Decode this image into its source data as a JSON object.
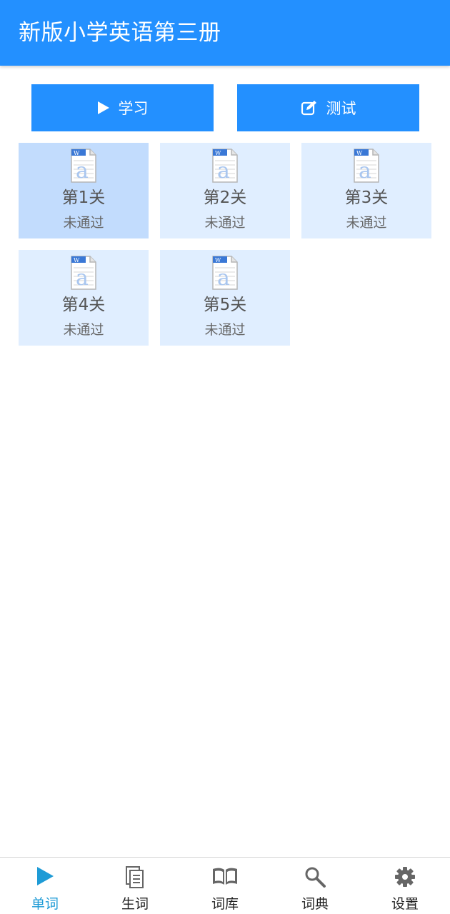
{
  "header": {
    "title": "新版小学英语第三册"
  },
  "actions": {
    "study_label": "学习",
    "test_label": "测试"
  },
  "levels": [
    {
      "name": "第1关",
      "status": "未通过",
      "selected": true
    },
    {
      "name": "第2关",
      "status": "未通过"
    },
    {
      "name": "第3关",
      "status": "未通过"
    },
    {
      "name": "第4关",
      "status": "未通过"
    },
    {
      "name": "第5关",
      "status": "未通过"
    }
  ],
  "nav": {
    "items": [
      {
        "label": "单词",
        "icon": "play-icon",
        "active": true
      },
      {
        "label": "生词",
        "icon": "document-icon"
      },
      {
        "label": "词库",
        "icon": "book-icon"
      },
      {
        "label": "词典",
        "icon": "search-icon"
      },
      {
        "label": "设置",
        "icon": "gear-icon"
      }
    ]
  },
  "colors": {
    "primary": "#2390ff",
    "tile": "#e0eeff",
    "tile_selected": "#c2dcfd",
    "nav_active": "#1e9bd6"
  }
}
